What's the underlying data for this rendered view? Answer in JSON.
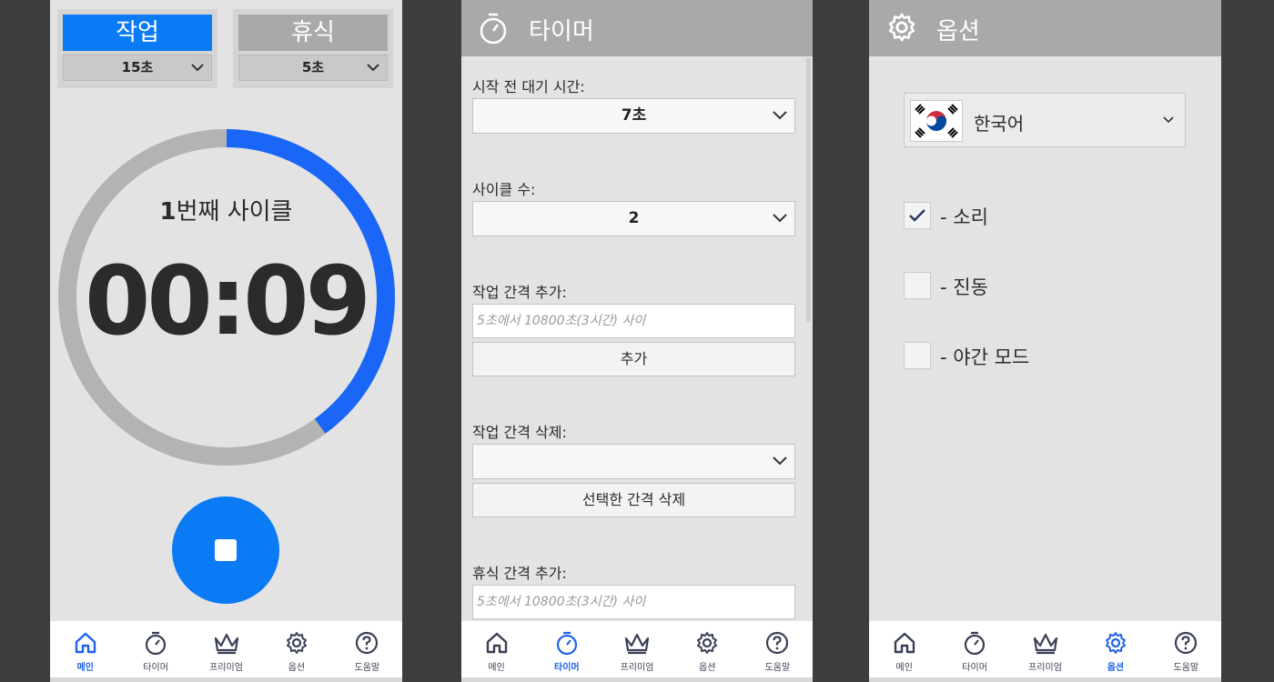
{
  "colors": {
    "accent": "#1a66f7",
    "primary_button": "#0a7bf5",
    "ring_track": "#b3b3b3",
    "inactive_mode": "#a9a9a9"
  },
  "nav": {
    "items": [
      {
        "label": "메인",
        "icon": "home-icon"
      },
      {
        "label": "타이머",
        "icon": "stopwatch-icon"
      },
      {
        "label": "프리미엄",
        "icon": "crown-icon"
      },
      {
        "label": "옵션",
        "icon": "gear-icon"
      },
      {
        "label": "도움말",
        "icon": "help-icon"
      }
    ]
  },
  "main": {
    "work_mode": {
      "label": "작업",
      "value": "15초"
    },
    "rest_mode": {
      "label": "휴식",
      "value": "5초"
    },
    "cycle_number": "1",
    "cycle_suffix": "번째 사이클",
    "time": "00:09",
    "progress_fraction": 0.4,
    "stop_icon": "stop-icon"
  },
  "timer": {
    "title": "타이머",
    "prestart_label": "시작 전 대기 시간:",
    "prestart_value": "7초",
    "cycles_label": "사이클 수:",
    "cycles_value": "2",
    "add_work_label": "작업 간격 추가:",
    "add_work_placeholder": "5초에서 10800초(3시간) 사이",
    "add_button": "추가",
    "delete_work_label": "작업 간격 삭제:",
    "delete_work_value": "",
    "delete_button": "선택한 간격 삭제",
    "add_rest_label": "휴식 간격 추가:",
    "add_rest_placeholder": "5초에서 10800초(3시간) 사이"
  },
  "options": {
    "title": "옵션",
    "language": "한국어",
    "flag_icon": "korea-flag-icon",
    "sound": {
      "label": "- 소리",
      "checked": true
    },
    "vibration": {
      "label": "- 진동",
      "checked": false
    },
    "night_mode": {
      "label": "- 야간 모드",
      "checked": false
    }
  }
}
